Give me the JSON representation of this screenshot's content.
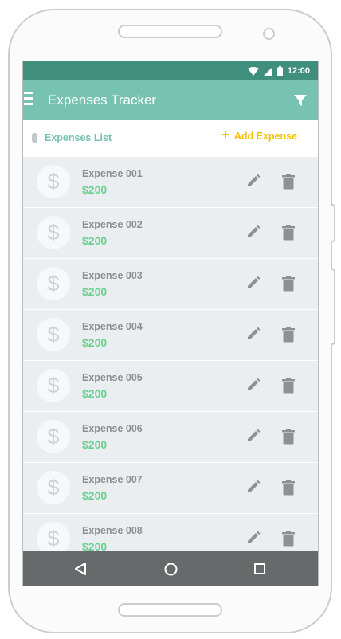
{
  "status": {
    "time": "12:00"
  },
  "appbar": {
    "title": "Expenses Tracker"
  },
  "subheader": {
    "list_label": "Expenses List",
    "add_plus": "+",
    "add_label": "Add Expense"
  },
  "expenses": [
    {
      "name": "Expense 001",
      "amount": "$200"
    },
    {
      "name": "Expense 002",
      "amount": "$200"
    },
    {
      "name": "Expense 003",
      "amount": "$200"
    },
    {
      "name": "Expense 004",
      "amount": "$200"
    },
    {
      "name": "Expense 005",
      "amount": "$200"
    },
    {
      "name": "Expense 006",
      "amount": "$200"
    },
    {
      "name": "Expense 007",
      "amount": "$200"
    },
    {
      "name": "Expense 008",
      "amount": "$200"
    }
  ],
  "avatar_glyph": "$",
  "icons": [
    "wifi-icon",
    "signal-icon",
    "battery-icon",
    "menu-icon",
    "filter-icon",
    "dollar-icon",
    "edit-icon",
    "delete-icon",
    "back-icon",
    "home-icon",
    "recent-apps-icon"
  ],
  "colors": {
    "status_bar": "#3f8f7c",
    "app_bar": "#77c2b0",
    "accent_add": "#f2c200",
    "amount": "#6ccf92",
    "list_bg": "#ebeef0",
    "nav_bar": "#676a6b"
  }
}
